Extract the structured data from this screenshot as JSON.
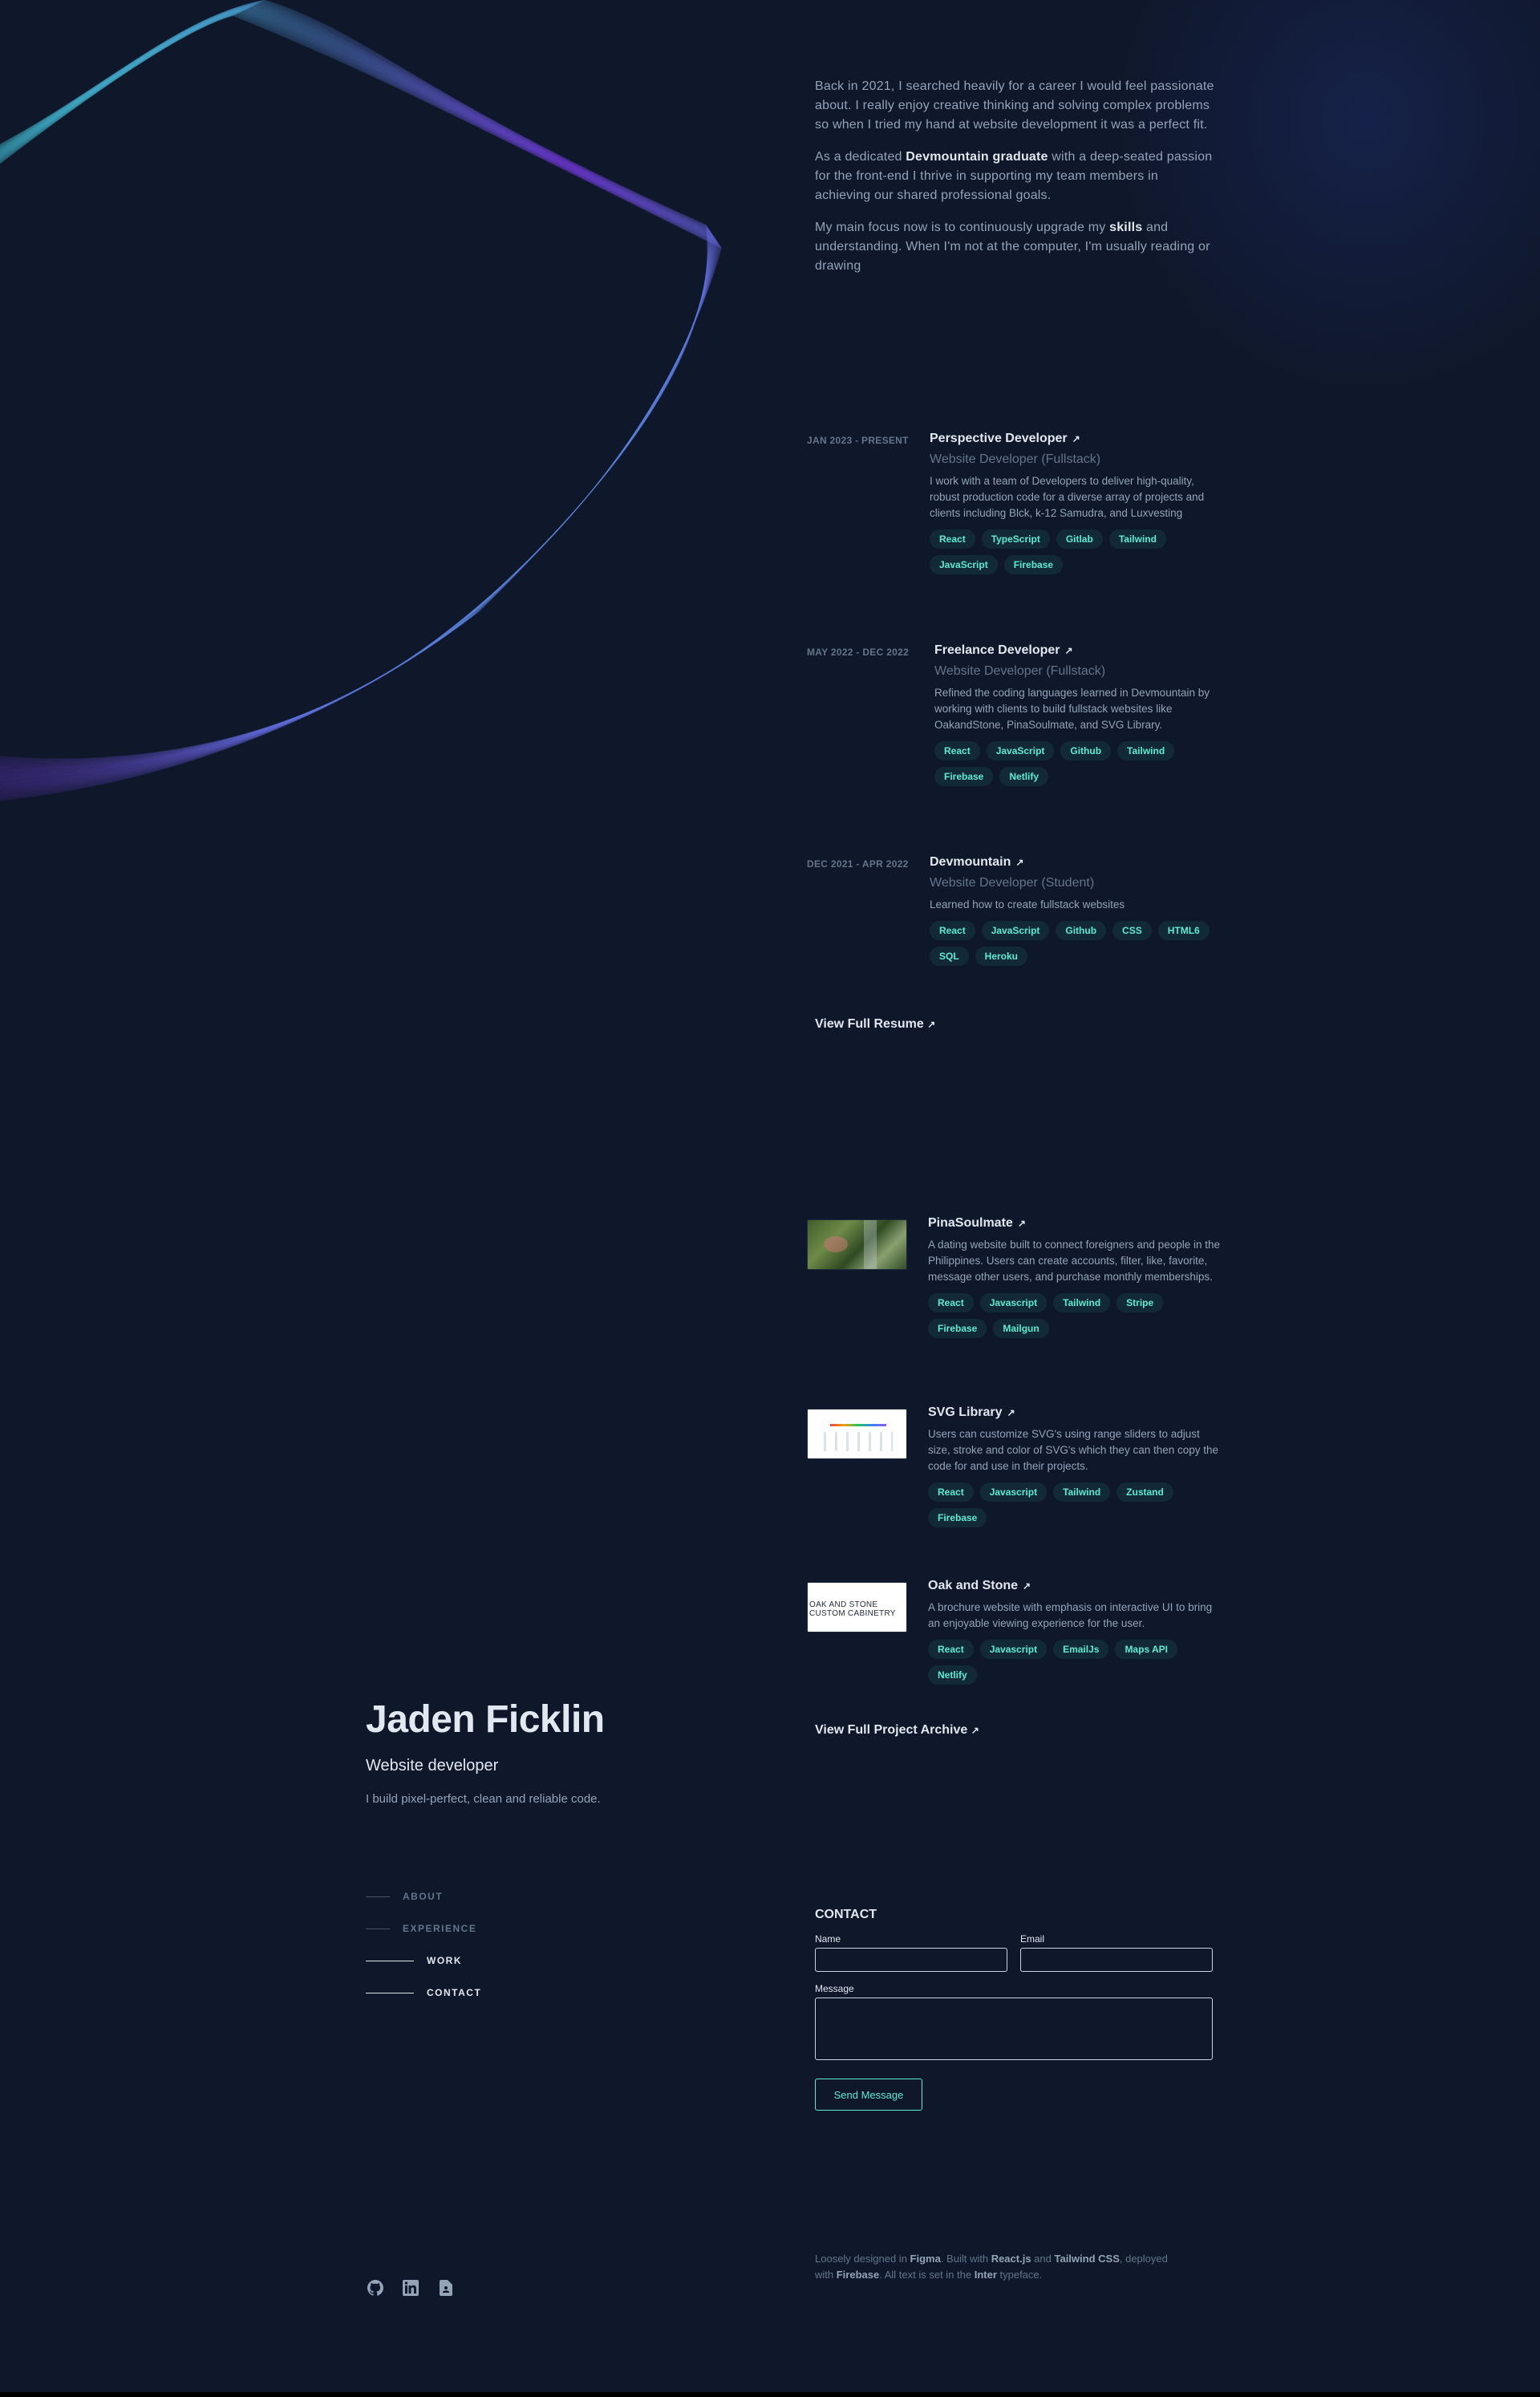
{
  "profile": {
    "name": "Jaden Ficklin",
    "role": "Website developer",
    "tagline": "I build pixel-perfect, clean and reliable code."
  },
  "nav": {
    "items": [
      {
        "label": "ABOUT",
        "active": false
      },
      {
        "label": "EXPERIENCE",
        "active": false
      },
      {
        "label": "WORK",
        "active": true
      },
      {
        "label": "CONTACT",
        "active": true
      }
    ]
  },
  "socials": [
    {
      "icon": "github-icon"
    },
    {
      "icon": "linkedin-icon"
    },
    {
      "icon": "resume-icon"
    }
  ],
  "about": {
    "p1": "Back in 2021, I searched heavily for a career I would feel passionate about. I really enjoy creative thinking and solving complex problems so when I tried my hand at website development it was a perfect fit.",
    "p2_pre": "As a dedicated ",
    "p2_bold": "Devmountain graduate",
    "p2_post": " with a deep-seated passion for the front-end I thrive in supporting my team members in achieving our shared professional goals.",
    "p3_pre": "My main focus now is to continuously upgrade my ",
    "p3_bold": "skills",
    "p3_post": " and understanding. When I'm not at the computer, I'm usually reading or drawing"
  },
  "experience": [
    {
      "date": "JAN 2023 - PRESENT",
      "title": "Perspective Developer",
      "subtitle": "Website Developer (Fullstack)",
      "description": "I work with a team of Developers to deliver high-quality, robust production code for a diverse array of projects and clients including Blck, k-12 Samudra, and Luxvesting",
      "tags": [
        "React",
        "TypeScript",
        "Gitlab",
        "Tailwind",
        "JavaScript",
        "Firebase"
      ]
    },
    {
      "date": "MAY 2022 - DEC 2022",
      "title": "Freelance Developer",
      "subtitle": "Website Developer (Fullstack)",
      "description": "Refined the coding languages learned in Devmountain by working with clients to build fullstack websites like OakandStone, PinaSoulmate, and SVG Library.",
      "tags": [
        "React",
        "JavaScript",
        "Github",
        "Tailwind",
        "Firebase",
        "Netlify"
      ]
    },
    {
      "date": "DEC 2021 - APR 2022",
      "title": "Devmountain",
      "subtitle": "Website Developer (Student)",
      "description": "Learned how to create fullstack websites",
      "tags": [
        "React",
        "JavaScript",
        "Github",
        "CSS",
        "HTML6",
        "SQL",
        "Heroku"
      ]
    }
  ],
  "resume_link": "View Full Resume",
  "projects": [
    {
      "title": "PinaSoulmate",
      "description": "A dating website built to connect foreigners and people in the Philippines. Users can create accounts, filter, like, favorite, message other users, and purchase monthly memberships.",
      "tags": [
        "React",
        "Javascript",
        "Tailwind",
        "Stripe",
        "Firebase",
        "Mailgun"
      ],
      "thumb_text": ""
    },
    {
      "title": "SVG Library",
      "description": "Users can customize SVG's using range sliders to adjust size, stroke and color of SVG's which they can then copy the code for and use in their projects.",
      "tags": [
        "React",
        "Javascript",
        "Tailwind",
        "Zustand",
        "Firebase"
      ],
      "thumb_text": ""
    },
    {
      "title": "Oak and Stone",
      "description": "A brochure website with emphasis on interactive UI to bring an enjoyable viewing experience for the user.",
      "tags": [
        "React",
        "Javascript",
        "EmailJs",
        "Maps API",
        "Netlify"
      ],
      "thumb_text": "OAK AND STONE CUSTOM CABINETRY"
    }
  ],
  "archive_link": "View Full Project Archive",
  "contact": {
    "title": "CONTACT",
    "name_label": "Name",
    "email_label": "Email",
    "message_label": "Message",
    "send_label": "Send Message"
  },
  "footer": {
    "t1": "Loosely designed in ",
    "b1": "Figma",
    "t2": ". Built with ",
    "b2": "React.js",
    "t3": " and ",
    "b3": "Tailwind CSS",
    "t4": ", deployed with ",
    "b4": "Firebase",
    "t5": ". All text is set in the ",
    "b5": "Inter",
    "t6": " typeface."
  },
  "colors": {
    "background": "#0f172a",
    "accent": "#5eead4",
    "heading": "#e2e8f0",
    "body": "#94a3b8"
  }
}
